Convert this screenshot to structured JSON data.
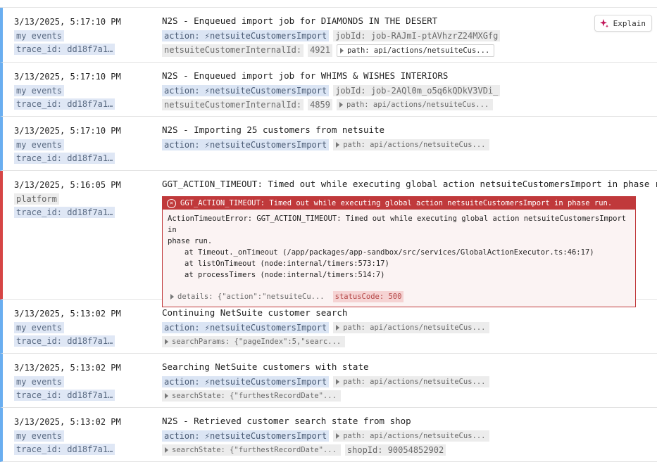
{
  "explain_button": {
    "label": "Explain",
    "icon": "sparkle-icon"
  },
  "rows": [
    {
      "timestamp": "3/13/2025, 5:17:10 PM",
      "source": "my events",
      "trace": "trace_id: dd18f7a1…",
      "message": "N2S - Enqueued import job for DIAMONDS IN THE DESERT",
      "chips": [
        "action: ⚡netsuiteCustomersImport",
        "jobId: job-RAJmI-ptAVhzrZ24MXGfg",
        "netsuiteCustomerInternalId:",
        "4921"
      ],
      "path": "path: api/actions/netsuiteCus..."
    },
    {
      "timestamp": "3/13/2025, 5:17:10 PM",
      "source": "my events",
      "trace": "trace_id: dd18f7a1…",
      "message": "N2S - Enqueued import job for WHIMS & WISHES INTERIORS",
      "chips": [
        "action: ⚡netsuiteCustomersImport",
        "jobId: job-2AQl0m_o5q6kQDkV3VDi_",
        "netsuiteCustomerInternalId:",
        "4859"
      ],
      "path": "path: api/actions/netsuiteCus..."
    },
    {
      "timestamp": "3/13/2025, 5:17:10 PM",
      "source": "my events",
      "trace": "trace_id: dd18f7a1…",
      "message": "N2S - Importing 25 customers from netsuite",
      "chips": [
        "action: ⚡netsuiteCustomersImport"
      ],
      "path": "path: api/actions/netsuiteCus..."
    },
    {
      "timestamp": "3/13/2025, 5:16:05 PM",
      "source": "platform",
      "trace": "trace_id: dd18f7a1…",
      "message": "GGT_ACTION_TIMEOUT: Timed out while executing global action netsuiteCustomersImport in phase run.",
      "error": {
        "header": "GGT_ACTION_TIMEOUT: Timed out while executing global action netsuiteCustomersImport in phase run.",
        "line1": "ActionTimeoutError: GGT_ACTION_TIMEOUT: Timed out while executing global action netsuiteCustomersImport in",
        "line2": "phase run.",
        "stack": [
          "at Timeout._onTimeout (/app/packages/app-sandbox/src/services/GlobalActionExecutor.ts:46:17)",
          "at listOnTimeout (node:internal/timers:573:17)",
          "at processTimers (node:internal/timers:514:7)"
        ],
        "details": "details: {\"action\":\"netsuiteCu...",
        "status": "statusCode: 500"
      }
    },
    {
      "timestamp": "3/13/2025, 5:13:02 PM",
      "source": "my events",
      "trace": "trace_id: dd18f7a1…",
      "message": "Continuing NetSuite customer search",
      "chips": [
        "action: ⚡netsuiteCustomersImport"
      ],
      "path": "path: api/actions/netsuiteCus...",
      "extra": "searchParams: {\"pageIndex\":5,\"searc..."
    },
    {
      "timestamp": "3/13/2025, 5:13:02 PM",
      "source": "my events",
      "trace": "trace_id: dd18f7a1…",
      "message": "Searching NetSuite customers with state",
      "chips": [
        "action: ⚡netsuiteCustomersImport"
      ],
      "path": "path: api/actions/netsuiteCus...",
      "extra": "searchState: {\"furthestRecordDate\"..."
    },
    {
      "timestamp": "3/13/2025, 5:13:02 PM",
      "source": "my events",
      "trace": "trace_id: dd18f7a1…",
      "message": "N2S - Retrieved customer search state from shop",
      "chips": [
        "action: ⚡netsuiteCustomersImport"
      ],
      "path": "path: api/actions/netsuiteCus...",
      "extra": "searchState: {\"furthestRecordDate\"...",
      "extra2": "shopId: 90054852902"
    }
  ]
}
